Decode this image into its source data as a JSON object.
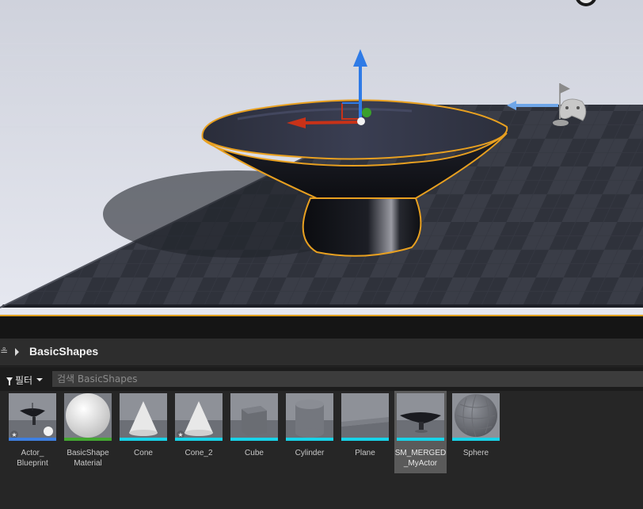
{
  "content_browser": {
    "path_prefix": "≗",
    "folder": "BasicShapes",
    "filter_label": "필터",
    "search_placeholder": "검색 BasicShapes",
    "assets": [
      {
        "label": "Actor_\nBlueprint",
        "icon": "blueprint-thumbnail",
        "type_color": "#3f7fe0"
      },
      {
        "label": "BasicShape\nMaterial",
        "icon": "material-sphere-thumbnail",
        "type_color": "#44a832"
      },
      {
        "label": "Cone",
        "icon": "cone-thumbnail",
        "type_color": "#18d3e8"
      },
      {
        "label": "Cone_2",
        "icon": "cone-thumbnail",
        "type_color": "#18d3e8"
      },
      {
        "label": "Cube",
        "icon": "cube-thumbnail",
        "type_color": "#18d3e8"
      },
      {
        "label": "Cylinder",
        "icon": "cylinder-thumbnail",
        "type_color": "#18d3e8"
      },
      {
        "label": "Plane",
        "icon": "plane-thumbnail",
        "type_color": "#18d3e8"
      },
      {
        "label": "SM_MERGED\n_MyActor",
        "icon": "merged-mesh-thumbnail",
        "type_color": "#18d3e8",
        "selected": true
      },
      {
        "label": "Sphere",
        "icon": "sphere-thumbnail",
        "type_color": "#18d3e8"
      }
    ]
  },
  "colors": {
    "selection_outline": "#e8a020",
    "gizmo_z": "#2f7be6",
    "gizmo_x": "#c83218",
    "gizmo_y": "#3aa02c"
  }
}
